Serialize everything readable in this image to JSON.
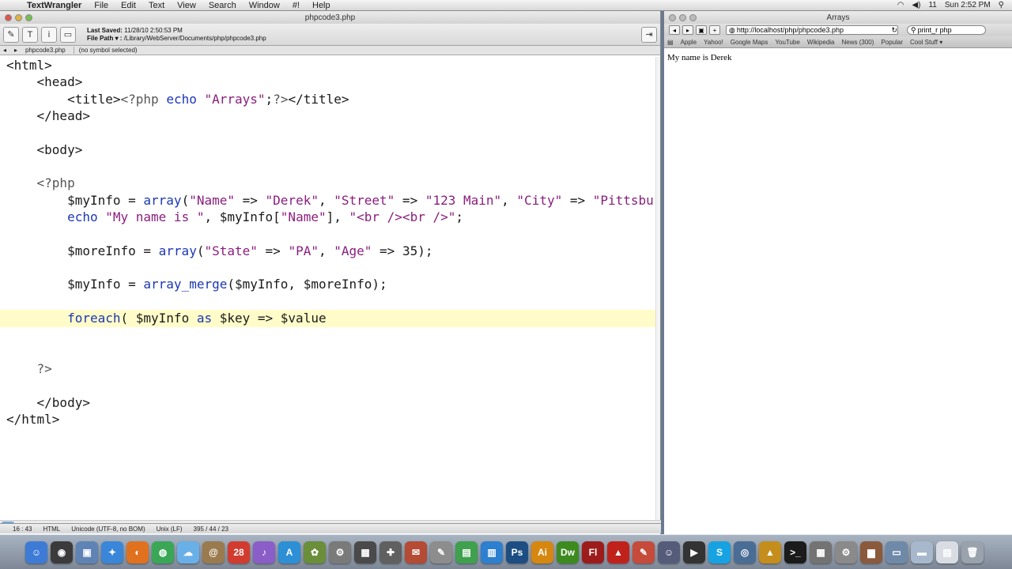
{
  "menubar": {
    "apple": "",
    "app_name": "TextWrangler",
    "items": [
      "File",
      "Edit",
      "Text",
      "View",
      "Search",
      "Window",
      "#!",
      "Help"
    ],
    "clock": "Sun 2:52 PM",
    "volume": "11"
  },
  "editor": {
    "window_title": "phpcode3.php",
    "last_saved_label": "Last Saved:",
    "last_saved_value": "11/28/10 2:50:53 PM",
    "file_path_label": "File Path ▾ :",
    "file_path_value": "/Library/WebServer/Documents/php/phpcode3.php",
    "nav_file": "phpcode3.php",
    "nav_symbol": "(no symbol selected)",
    "code_lines": [
      {
        "indent": "",
        "text": "<html>"
      },
      {
        "indent": "    ",
        "text": "<head>"
      },
      {
        "indent": "        ",
        "text": "<title><?php echo \"Arrays\";?></title>"
      },
      {
        "indent": "    ",
        "text": "</head>"
      },
      {
        "indent": "",
        "text": ""
      },
      {
        "indent": "    ",
        "text": "<body>"
      },
      {
        "indent": "",
        "text": ""
      },
      {
        "indent": "    ",
        "text": "<?php"
      },
      {
        "indent": "        ",
        "text": "$myInfo = array(\"Name\" => \"Derek\", \"Street\" => \"123 Main\", \"City\" => \"Pittsbur"
      },
      {
        "indent": "        ",
        "text": "echo \"My name is \", $myInfo[\"Name\"], \"<br /><br />\";"
      },
      {
        "indent": "",
        "text": ""
      },
      {
        "indent": "        ",
        "text": "$moreInfo = array(\"State\" => \"PA\", \"Age\" => 35);"
      },
      {
        "indent": "",
        "text": ""
      },
      {
        "indent": "        ",
        "text": "$myInfo = array_merge($myInfo, $moreInfo);"
      },
      {
        "indent": "",
        "text": ""
      },
      {
        "indent": "        ",
        "text": "foreach( $myInfo as $key => $value"
      },
      {
        "indent": "",
        "text": ""
      },
      {
        "indent": "",
        "text": ""
      },
      {
        "indent": "    ",
        "text": "?>"
      },
      {
        "indent": "",
        "text": ""
      },
      {
        "indent": "    ",
        "text": "</body>"
      },
      {
        "indent": "",
        "text": "</html>"
      }
    ],
    "highlight_line": 15,
    "status": {
      "position": "16 : 43",
      "language": "HTML",
      "encoding": "Unicode (UTF-8, no BOM)",
      "line_endings": "Unix (LF)",
      "counts": "395 / 44 / 23"
    }
  },
  "browser": {
    "window_title": "Arrays",
    "url": "http://localhost/php/phpcode3.php",
    "search_value": "print_r php",
    "bookmarks": [
      "Apple",
      "Yahoo!",
      "Google Maps",
      "YouTube",
      "Wikipedia",
      "News (300)",
      "Popular",
      "Cool Stuff ▾"
    ],
    "content_text": "My name is Derek"
  },
  "dock": {
    "apps": [
      {
        "name": "finder",
        "glyph": "☺",
        "color": "#3d7bd6"
      },
      {
        "name": "dashboard",
        "glyph": "◉",
        "color": "#3b3b3b"
      },
      {
        "name": "preview",
        "glyph": "▣",
        "color": "#5f83b5"
      },
      {
        "name": "safari",
        "glyph": "✦",
        "color": "#3a86d9"
      },
      {
        "name": "firefox",
        "glyph": "◐",
        "color": "#e0721f"
      },
      {
        "name": "chrome",
        "glyph": "◍",
        "color": "#3aa757"
      },
      {
        "name": "ichat",
        "glyph": "☁",
        "color": "#6ab0e8"
      },
      {
        "name": "address-book",
        "glyph": "@",
        "color": "#9a7b4f"
      },
      {
        "name": "ical",
        "glyph": "28",
        "color": "#d23c2f"
      },
      {
        "name": "itunes",
        "glyph": "♪",
        "color": "#8a5dc8"
      },
      {
        "name": "app-store",
        "glyph": "A",
        "color": "#2d8fd5"
      },
      {
        "name": "photos",
        "glyph": "✿",
        "color": "#6b8e3a"
      },
      {
        "name": "automator",
        "glyph": "⚙",
        "color": "#7a7a7a"
      },
      {
        "name": "grid",
        "glyph": "▦",
        "color": "#4a4a4a"
      },
      {
        "name": "utility",
        "glyph": "✚",
        "color": "#606060"
      },
      {
        "name": "mail-stamp",
        "glyph": "✉",
        "color": "#b54b35"
      },
      {
        "name": "script",
        "glyph": "✎",
        "color": "#8d8d8d"
      },
      {
        "name": "numbers",
        "glyph": "▤",
        "color": "#3fa04d"
      },
      {
        "name": "pages",
        "glyph": "▥",
        "color": "#2d7fd0"
      },
      {
        "name": "photoshop",
        "glyph": "Ps",
        "color": "#1c4e83"
      },
      {
        "name": "illustrator",
        "glyph": "Ai",
        "color": "#d6870f"
      },
      {
        "name": "dreamweaver",
        "glyph": "Dw",
        "color": "#3d8a1f"
      },
      {
        "name": "flash",
        "glyph": "Fl",
        "color": "#9c1c1c"
      },
      {
        "name": "acrobat",
        "glyph": "▲",
        "color": "#c0221b"
      },
      {
        "name": "textwrangler",
        "glyph": "✎",
        "color": "#c64b3a"
      },
      {
        "name": "camino",
        "glyph": "☺",
        "color": "#555c7a"
      },
      {
        "name": "clapper",
        "glyph": "▶",
        "color": "#333"
      },
      {
        "name": "skype",
        "glyph": "S",
        "color": "#17a3e3"
      },
      {
        "name": "network",
        "glyph": "◎",
        "color": "#4a6d95"
      },
      {
        "name": "vlc",
        "glyph": "▲",
        "color": "#c58d1c"
      },
      {
        "name": "terminal",
        "glyph": ">_",
        "color": "#1b1b1b"
      },
      {
        "name": "calculator",
        "glyph": "▩",
        "color": "#737373"
      },
      {
        "name": "system-prefs",
        "glyph": "⚙",
        "color": "#8a8a8a"
      },
      {
        "name": "wood",
        "glyph": "▆",
        "color": "#8b5a3c"
      },
      {
        "name": "screen",
        "glyph": "▭",
        "color": "#6f8aa8"
      },
      {
        "name": "folder",
        "glyph": "▬",
        "color": "#a7b8cc"
      },
      {
        "name": "documents",
        "glyph": "▤",
        "color": "#d9dde3"
      },
      {
        "name": "trash",
        "glyph": "🗑",
        "color": "#9aa3ad"
      }
    ]
  }
}
